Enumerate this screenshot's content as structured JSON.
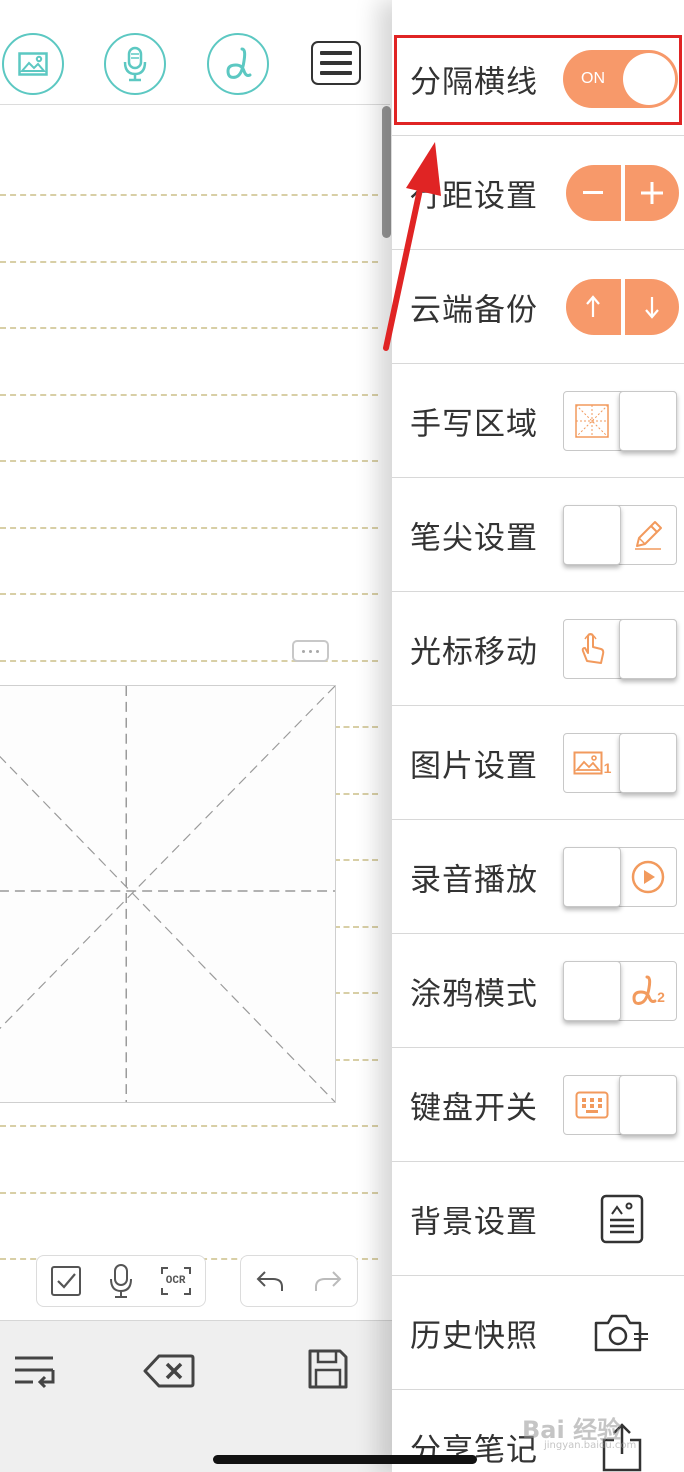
{
  "toolbar": {
    "icons": [
      "image-insert-icon",
      "microphone-icon",
      "doodle-pen-icon",
      "menu-list-icon"
    ]
  },
  "editor": {
    "more_button": "more-dots-icon",
    "tools_left": [
      "checkbox-icon",
      "microphone-icon",
      "ocr-icon"
    ],
    "ocr_label": "OCR",
    "tools_right": [
      "undo-icon",
      "redo-icon"
    ],
    "bottom_bar": [
      "line-break-icon",
      "backspace-icon",
      "save-icon"
    ]
  },
  "panel": {
    "rows": [
      {
        "label": "分隔横线",
        "control": "toggle",
        "toggle_text": "ON",
        "value": "on"
      },
      {
        "label": "行距设置",
        "control": "stepper",
        "buttons": [
          "−",
          "+"
        ]
      },
      {
        "label": "云端备份",
        "control": "updown",
        "buttons": [
          "↑",
          "↓"
        ]
      },
      {
        "label": "手写区域",
        "control": "switch",
        "icon": "grid-box-icon"
      },
      {
        "label": "笔尖设置",
        "control": "switch",
        "icon": "pencil-icon"
      },
      {
        "label": "光标移动",
        "control": "switch",
        "icon": "finger-tap-icon"
      },
      {
        "label": "图片设置",
        "control": "switch",
        "icon": "image-icon",
        "badge": "1"
      },
      {
        "label": "录音播放",
        "control": "switch",
        "icon": "play-circle-icon"
      },
      {
        "label": "涂鸦模式",
        "control": "switch",
        "icon": "doodle-icon",
        "badge": "2"
      },
      {
        "label": "键盘开关",
        "control": "switch",
        "icon": "keyboard-icon"
      },
      {
        "label": "背景设置",
        "control": "icon",
        "icon": "background-icon"
      },
      {
        "label": "历史快照",
        "control": "icon",
        "icon": "camera-icon"
      },
      {
        "label": "分享笔记",
        "control": "icon",
        "icon": "share-icon"
      }
    ]
  },
  "watermark": {
    "text": "Bai 经验",
    "sub": "jingyan.baidu.com"
  },
  "colors": {
    "accent": "#f7996a",
    "teal": "#5cc8c2",
    "highlight": "#e02424"
  }
}
